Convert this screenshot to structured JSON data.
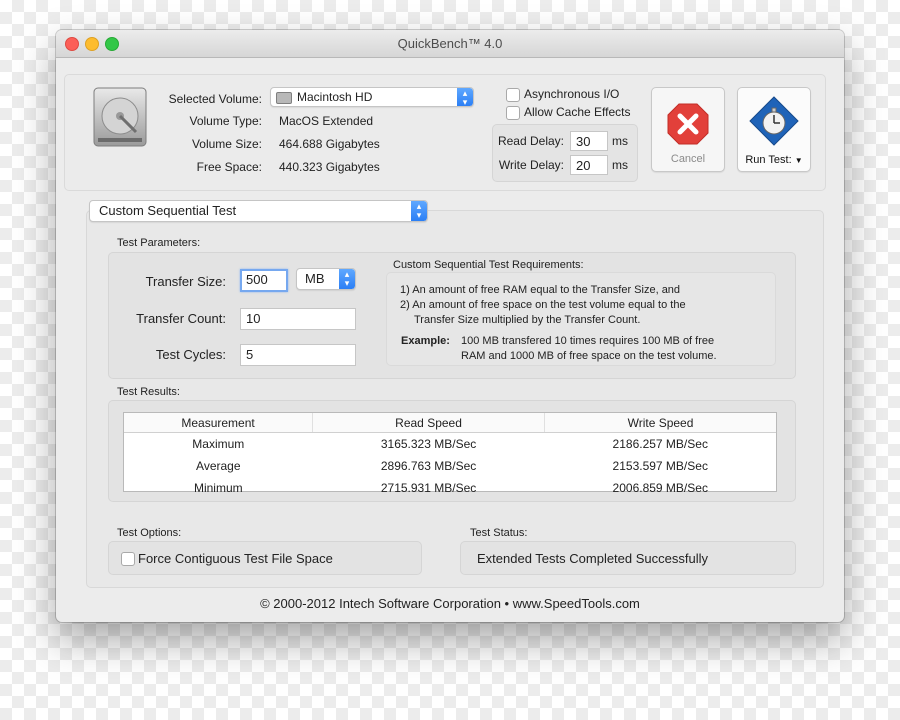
{
  "window": {
    "title": "QuickBench™ 4.0"
  },
  "volume": {
    "selected_label": "Selected Volume:",
    "selected_value": "Macintosh HD",
    "type_label": "Volume Type:",
    "type_value": "MacOS Extended",
    "size_label": "Volume Size:",
    "size_value": "464.688 Gigabytes",
    "free_label": "Free Space:",
    "free_value": "440.323 Gigabytes"
  },
  "options": {
    "async_label": "Asynchronous I/O",
    "async_checked": false,
    "cache_label": "Allow Cache Effects",
    "cache_checked": false,
    "read_delay_label": "Read Delay:",
    "read_delay_value": "30",
    "read_delay_unit": "ms",
    "write_delay_label": "Write Delay:",
    "write_delay_value": "20",
    "write_delay_unit": "ms"
  },
  "buttons": {
    "cancel": "Cancel",
    "run_test": "Run Test:"
  },
  "test_select": {
    "value": "Custom Sequential Test"
  },
  "params": {
    "title": "Test Parameters:",
    "transfer_size_label": "Transfer Size:",
    "transfer_size_value": "500",
    "transfer_size_unit": "MB",
    "transfer_count_label": "Transfer Count:",
    "transfer_count_value": "10",
    "test_cycles_label": "Test Cycles:",
    "test_cycles_value": "5"
  },
  "requirements": {
    "title": "Custom Sequential Test Requirements:",
    "line1": "1) An amount of free RAM equal to the Transfer Size, and",
    "line2a": "2) An amount of free space on the test volume equal to the",
    "line2b": "Transfer Size multiplied by the Transfer Count.",
    "example_label": "Example:",
    "example_line1": "100 MB transfered 10 times requires 100 MB of free",
    "example_line2": "RAM and 1000 MB of free space on the test volume."
  },
  "results": {
    "title": "Test Results:",
    "columns": [
      "Measurement",
      "Read Speed",
      "Write Speed"
    ],
    "rows": [
      [
        "Maximum",
        "3165.323 MB/Sec",
        "2186.257 MB/Sec"
      ],
      [
        "Average",
        "2896.763 MB/Sec",
        "2153.597 MB/Sec"
      ],
      [
        "Minimum",
        "2715.931 MB/Sec",
        "2006.859 MB/Sec"
      ]
    ]
  },
  "test_options": {
    "title": "Test Options:",
    "contiguous_label": "Force Contiguous Test File Space",
    "contiguous_checked": false
  },
  "test_status": {
    "title": "Test Status:",
    "value": "Extended Tests Completed Successfully"
  },
  "footer": {
    "copyright": "© 2000-2012 Intech Software Corporation • www.SpeedTools.com"
  },
  "colors": {
    "accent": "#2b7ff5",
    "cancel_red": "#e2403a"
  },
  "icons": {
    "volume": "hard-drive-icon",
    "cancel": "stop-x-icon",
    "run": "stopwatch-icon"
  }
}
